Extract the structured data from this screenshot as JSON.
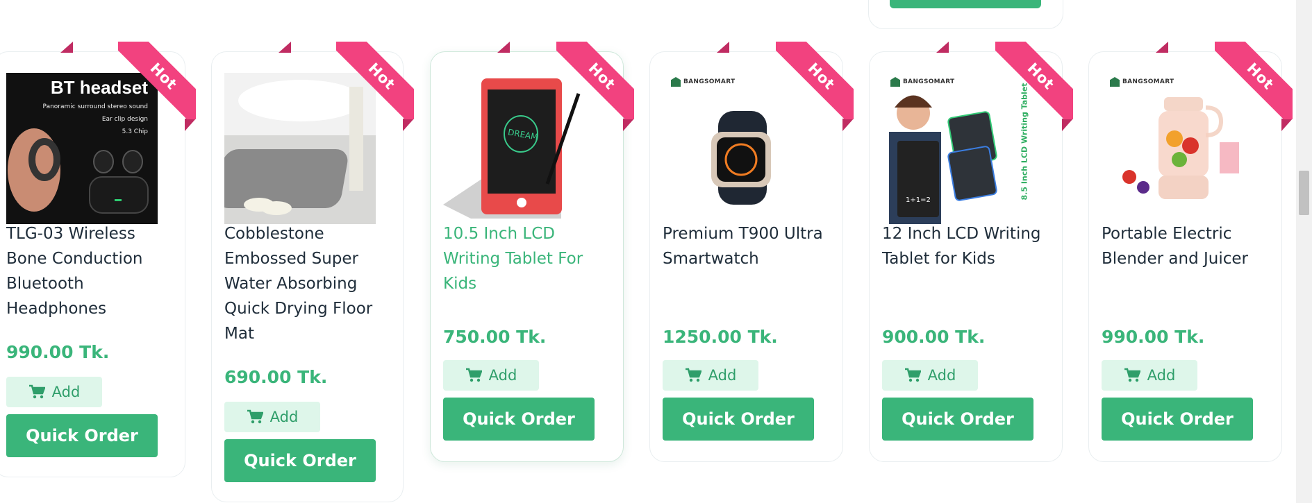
{
  "colors": {
    "accent": "#3ab57a",
    "add_bg": "#def6ea",
    "ribbon": "#f2427f",
    "text": "#1f2d3a"
  },
  "badge_label": "Hot",
  "add_label": "Add",
  "quick_order_label": "Quick Order",
  "brand_label": "BANGSOMART",
  "products": [
    {
      "title": "TLG-03 Wireless Bone Conduction Bluetooth Headphones",
      "price": "990.00 Tk.",
      "image_caption": "BT headset",
      "image_lines": [
        "Panoramic surround stereo sound",
        "Ear clip design",
        "5.3 Chip"
      ]
    },
    {
      "title": "Cobblestone Embossed Super Water Absorbing Quick Drying Floor Mat",
      "price": "690.00 Tk."
    },
    {
      "title": "10.5 Inch LCD Writing Tablet For Kids",
      "price": "750.00 Tk.",
      "image_text": "DREAM"
    },
    {
      "title": "Premium T900 Ultra Smartwatch",
      "price": "1250.00 Tk."
    },
    {
      "title": "12 Inch LCD Writing Tablet for Kids",
      "price": "900.00 Tk.",
      "image_side_text": "8.5 Inch LCD Writing Tablet",
      "image_board_text": "1+1=2"
    },
    {
      "title": "Portable Electric Blender and Juicer",
      "price": "990.00 Tk."
    }
  ]
}
